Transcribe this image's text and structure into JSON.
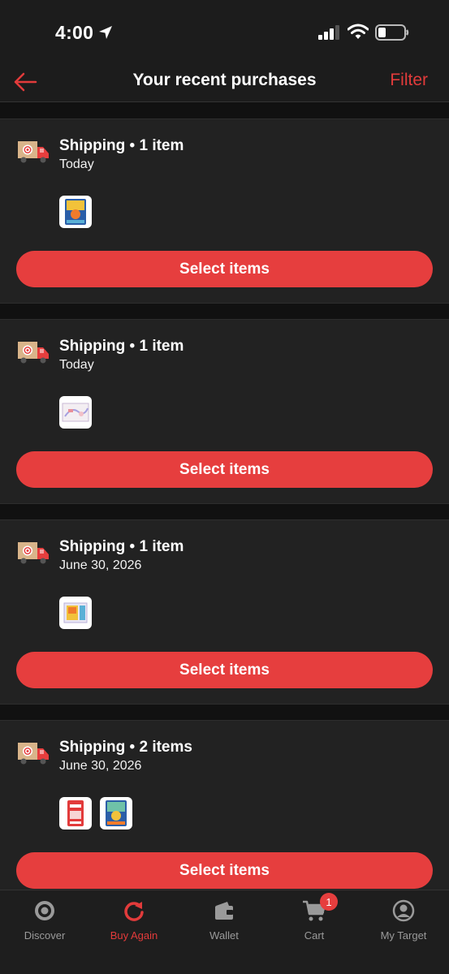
{
  "status_bar": {
    "time": "4:00"
  },
  "header": {
    "title": "Your recent purchases",
    "filter_label": "Filter"
  },
  "orders": [
    {
      "title": "Shipping • 1 item",
      "date": "Today",
      "button_label": "Select items"
    },
    {
      "title": "Shipping • 1 item",
      "date": "Today",
      "button_label": "Select items"
    },
    {
      "title": "Shipping • 1 item",
      "date": "June 30, 2026",
      "button_label": "Select items"
    },
    {
      "title": "Shipping • 2 items",
      "date": "June 30, 2026",
      "button_label": "Select items"
    }
  ],
  "tab_bar": {
    "tabs": [
      {
        "label": "Discover",
        "icon": "target-icon"
      },
      {
        "label": "Buy Again",
        "icon": "refresh-icon",
        "active": true
      },
      {
        "label": "Wallet",
        "icon": "wallet-icon"
      },
      {
        "label": "Cart",
        "icon": "cart-icon",
        "badge": "1"
      },
      {
        "label": "My Target",
        "icon": "profile-icon"
      }
    ]
  },
  "colors": {
    "accent": "#e63e3e",
    "background": "#111111",
    "card": "#222222",
    "inactive_tab": "#9a9a9a"
  }
}
